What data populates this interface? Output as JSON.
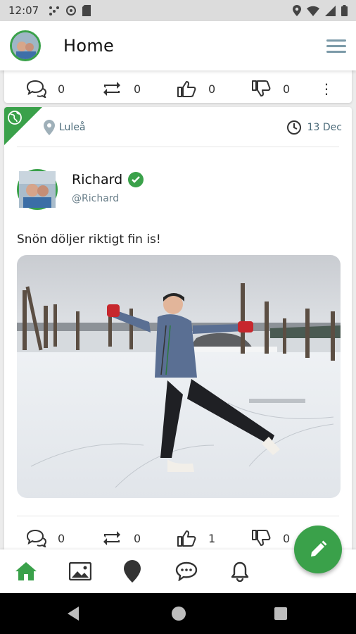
{
  "status_bar": {
    "time": "12:07"
  },
  "app_bar": {
    "title": "Home"
  },
  "post_prev": {
    "comments": "0",
    "reposts": "0",
    "likes": "0",
    "dislikes": "0",
    "more": "⋮"
  },
  "post": {
    "location": "Luleå",
    "date": "13 Dec",
    "author_name": "Richard",
    "author_handle": "@Richard",
    "text": "Snön döljer riktigt fin is!",
    "comments": "0",
    "reposts": "0",
    "likes": "1",
    "dislikes": "0"
  },
  "bottom_nav": {
    "items": [
      {
        "icon": "home-icon",
        "active": true
      },
      {
        "icon": "image-icon",
        "active": false
      },
      {
        "icon": "map-pin-icon",
        "active": false
      },
      {
        "icon": "chat-icon",
        "active": false
      },
      {
        "icon": "bell-icon",
        "active": false
      }
    ]
  },
  "colors": {
    "accent": "#3aa14a",
    "meta_text": "#4b6a79"
  }
}
